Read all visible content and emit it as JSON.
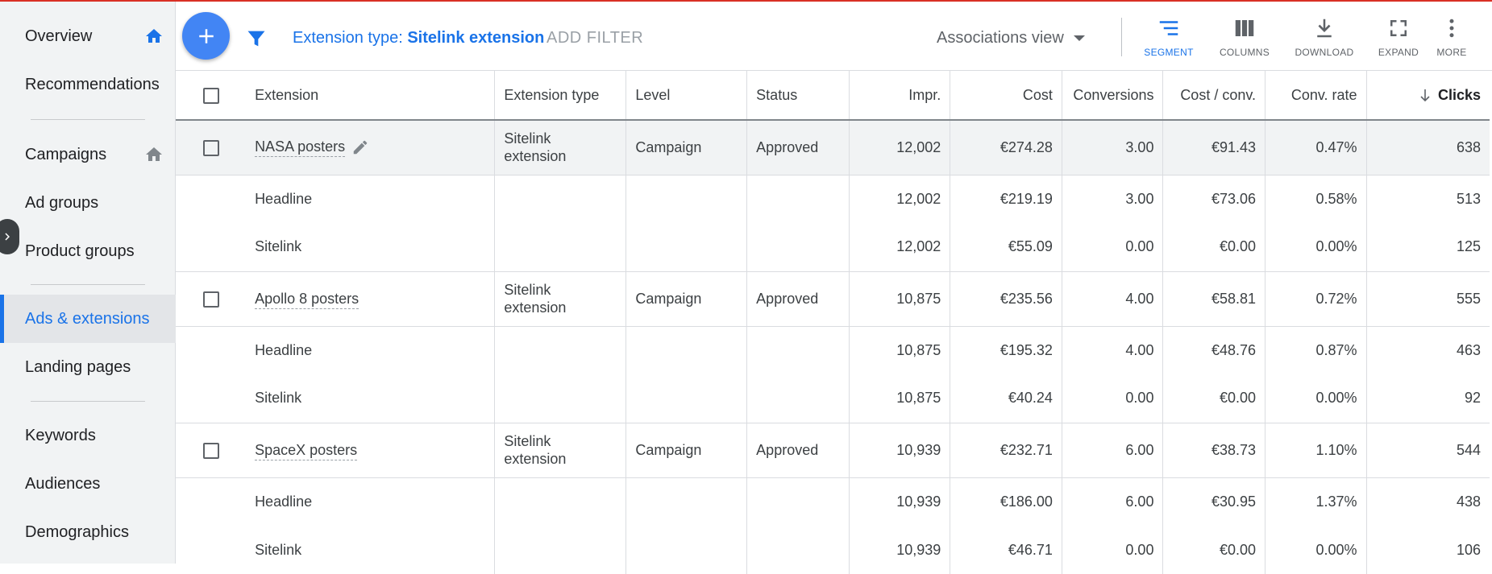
{
  "sidebar": {
    "items": [
      {
        "label": "Overview",
        "icon": "home-icon"
      },
      {
        "label": "Recommendations"
      },
      {
        "label": "Campaigns",
        "icon": "home-icon"
      },
      {
        "label": "Ad groups"
      },
      {
        "label": "Product groups"
      },
      {
        "label": "Ads & extensions",
        "active": true
      },
      {
        "label": "Landing pages"
      },
      {
        "label": "Keywords"
      },
      {
        "label": "Audiences"
      },
      {
        "label": "Demographics"
      }
    ]
  },
  "toolbar": {
    "filter_prefix": "Extension type:",
    "filter_value": "Sitelink extension",
    "add_filter": "ADD FILTER",
    "view_select": "Associations view",
    "tools": [
      {
        "label": "SEGMENT",
        "icon": "segment-icon"
      },
      {
        "label": "COLUMNS",
        "icon": "columns-icon"
      },
      {
        "label": "DOWNLOAD",
        "icon": "download-icon"
      },
      {
        "label": "EXPAND",
        "icon": "expand-icon"
      },
      {
        "label": "MORE",
        "icon": "more-vert-icon"
      }
    ]
  },
  "table": {
    "headers": [
      "Extension",
      "Extension type",
      "Level",
      "Status",
      "Impr.",
      "Cost",
      "Conversions",
      "Cost / conv.",
      "Conv. rate",
      "Clicks"
    ],
    "groups": [
      {
        "parent": {
          "extension": "NASA posters",
          "type": "Sitelink extension",
          "level": "Campaign",
          "status": "Approved",
          "impr": "12,002",
          "cost": "€274.28",
          "conv": "3.00",
          "cost_conv": "€91.43",
          "conv_rate": "0.47%",
          "clicks": "638"
        },
        "children": [
          {
            "extension": "Headline",
            "impr": "12,002",
            "cost": "€219.19",
            "conv": "3.00",
            "cost_conv": "€73.06",
            "conv_rate": "0.58%",
            "clicks": "513"
          },
          {
            "extension": "Sitelink",
            "impr": "12,002",
            "cost": "€55.09",
            "conv": "0.00",
            "cost_conv": "€0.00",
            "conv_rate": "0.00%",
            "clicks": "125"
          }
        ]
      },
      {
        "parent": {
          "extension": "Apollo 8 posters",
          "type": "Sitelink extension",
          "level": "Campaign",
          "status": "Approved",
          "impr": "10,875",
          "cost": "€235.56",
          "conv": "4.00",
          "cost_conv": "€58.81",
          "conv_rate": "0.72%",
          "clicks": "555"
        },
        "children": [
          {
            "extension": "Headline",
            "impr": "10,875",
            "cost": "€195.32",
            "conv": "4.00",
            "cost_conv": "€48.76",
            "conv_rate": "0.87%",
            "clicks": "463"
          },
          {
            "extension": "Sitelink",
            "impr": "10,875",
            "cost": "€40.24",
            "conv": "0.00",
            "cost_conv": "€0.00",
            "conv_rate": "0.00%",
            "clicks": "92"
          }
        ]
      },
      {
        "parent": {
          "extension": "SpaceX posters",
          "type": "Sitelink extension",
          "level": "Campaign",
          "status": "Approved",
          "impr": "10,939",
          "cost": "€232.71",
          "conv": "6.00",
          "cost_conv": "€38.73",
          "conv_rate": "1.10%",
          "clicks": "544"
        },
        "children": [
          {
            "extension": "Headline",
            "impr": "10,939",
            "cost": "€186.00",
            "conv": "6.00",
            "cost_conv": "€30.95",
            "conv_rate": "1.37%",
            "clicks": "438"
          },
          {
            "extension": "Sitelink",
            "impr": "10,939",
            "cost": "€46.71",
            "conv": "0.00",
            "cost_conv": "€0.00",
            "conv_rate": "0.00%",
            "clicks": "106"
          }
        ]
      }
    ]
  },
  "colors": {
    "accent": "#1a73e8",
    "fab": "#4285f4",
    "alert_line": "#d93025"
  }
}
